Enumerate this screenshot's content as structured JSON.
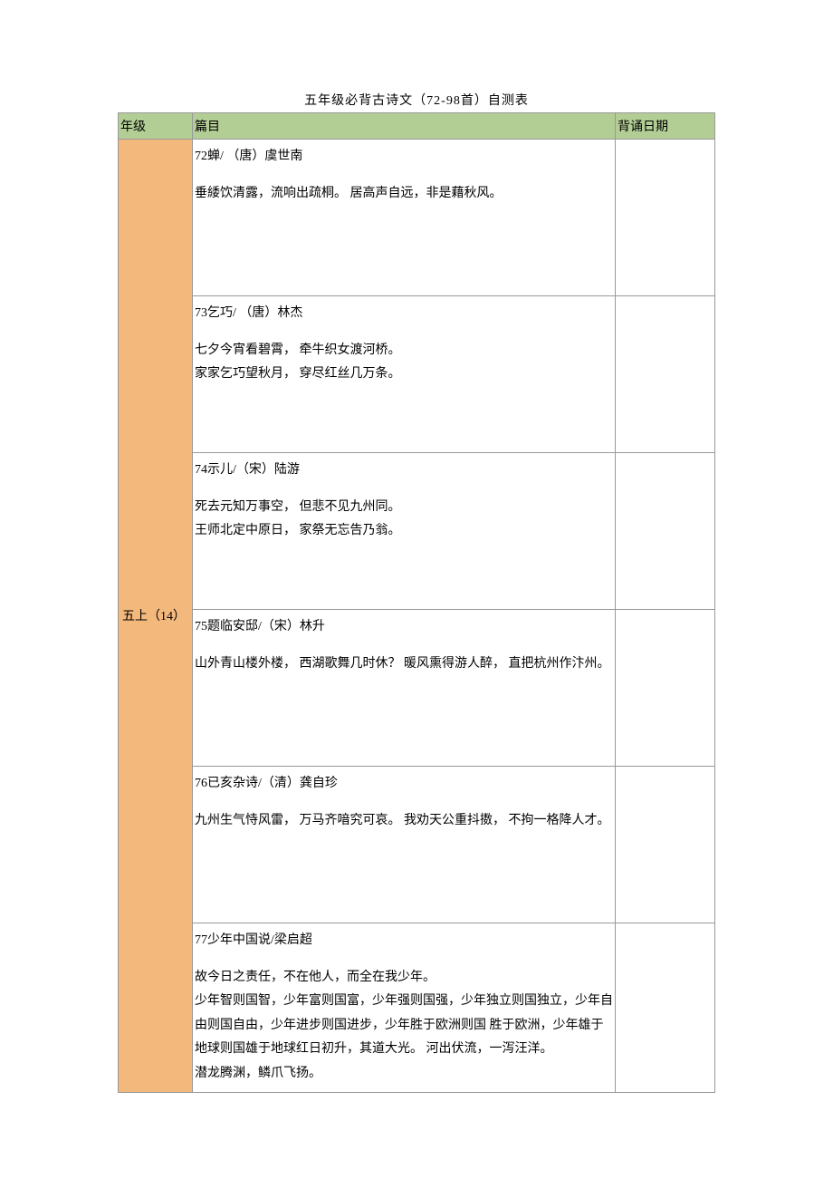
{
  "title": "五年级必背古诗文（72-98首）自测表",
  "headers": {
    "grade": "年级",
    "content": "篇目",
    "date": "背诵日期"
  },
  "grade_label": "五上（14）",
  "rows": [
    {
      "title": "72蝉/ （唐）虞世南",
      "body": "垂緌饮清露，流响出疏桐。 居高声自远，非是藉秋风。"
    },
    {
      "title": "73乞巧/ （唐）林杰",
      "body": "七夕今宵看碧霄， 牵牛织女渡河桥。\n家家乞巧望秋月， 穿尽红丝几万条。"
    },
    {
      "title": "74示儿/（宋）陆游",
      "body": "死去元知万事空， 但悲不见九州同。\n王师北定中原日， 家祭无忘告乃翁。"
    },
    {
      "title": "75题临安邸/（宋）林升",
      "body": "山外青山楼外楼， 西湖歌舞几时休？ 暖风熏得游人醉， 直把杭州作汴州。"
    },
    {
      "title": "76已亥杂诗/（清）龚自珍",
      "body": "九州生气恃风雷， 万马齐喑究可哀。 我劝天公重抖擞， 不拘一格降人才。"
    },
    {
      "title": "77少年中国说/梁启超",
      "body": "故今日之责任，不在他人，而全在我少年。\n少年智则国智，少年富则国富，少年强则国强，少年独立则国独立，少年自由则国自由，少年进步则国进步，少年胜于欧洲则国 胜于欧洲，少年雄于地球则国雄于地球红日初升，其道大光。 河出伏流，一泻汪洋。\n潜龙腾渊，鳞爪飞扬。"
    }
  ]
}
